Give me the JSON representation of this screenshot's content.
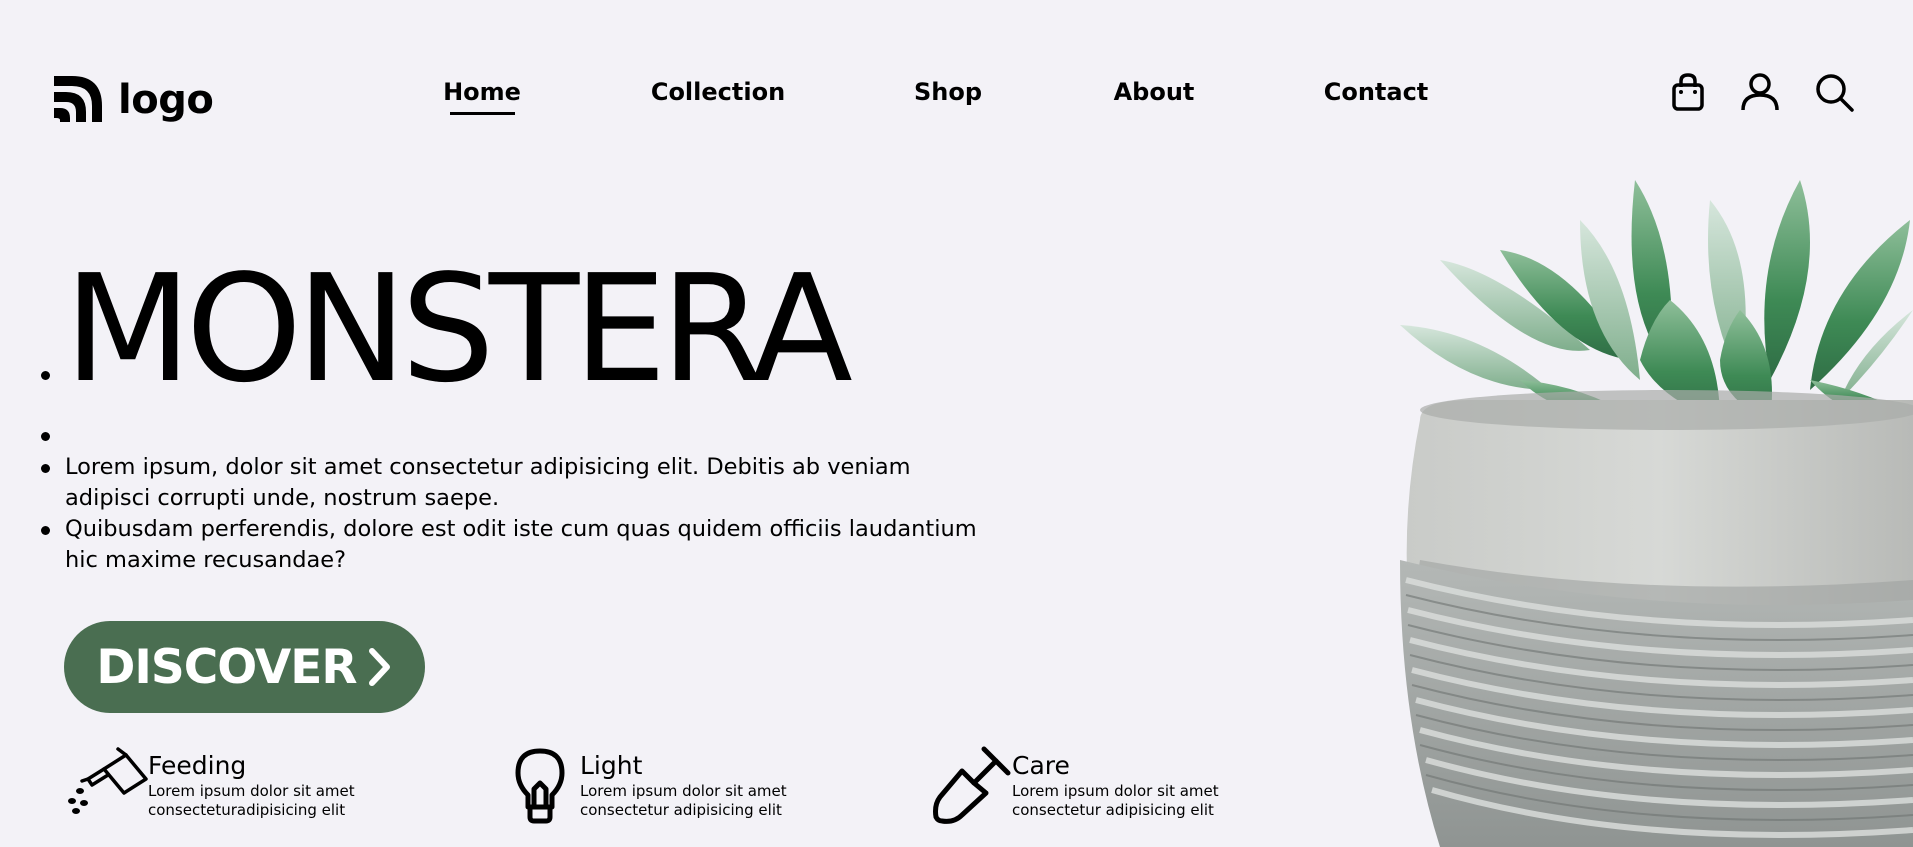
{
  "header": {
    "logo_text": "logo",
    "nav": [
      {
        "label": "Home",
        "active": true
      },
      {
        "label": "Collection",
        "active": false
      },
      {
        "label": "Shop",
        "active": false
      },
      {
        "label": "About",
        "active": false
      },
      {
        "label": "Contact",
        "active": false
      }
    ],
    "icons": [
      "shopping-bag-icon",
      "user-icon",
      "search-icon"
    ]
  },
  "hero": {
    "title": "MONSTERA",
    "paragraphs": [
      "Lorem ipsum, dolor sit amet consectetur adipisicing elit. Debitis ab veniam adipisci corrupti unde, nostrum saepe.",
      "Quibusdam perferendis, dolore est odit iste cum quas quidem officiis laudantium hic maxime recusandae?"
    ],
    "cta_label": "DISCOVER",
    "cta_color": "#4a6e51"
  },
  "features": [
    {
      "icon": "watering-can-icon",
      "title": "Feeding",
      "desc_line1": "Lorem ipsum dolor sit amet",
      "desc_line2": "consecteturadipisicing elit"
    },
    {
      "icon": "lightbulb-icon",
      "title": "Light",
      "desc_line1": "Lorem ipsum dolor sit amet",
      "desc_line2": "consectetur adipisicing elit"
    },
    {
      "icon": "shovel-icon",
      "title": "Care",
      "desc_line1": "Lorem ipsum dolor sit amet",
      "desc_line2": "consectetur adipisicing elit"
    }
  ],
  "colors": {
    "background": "#f3f2f7",
    "accent": "#4a6e51",
    "text": "#000000"
  }
}
